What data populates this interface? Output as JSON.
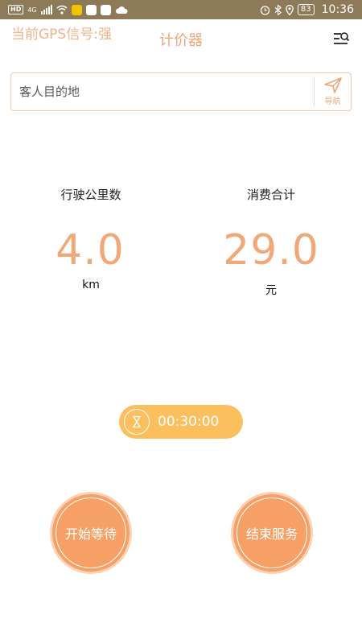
{
  "status_bar": {
    "hd_badge": "HD",
    "network": "4G",
    "battery": "83",
    "time": "10:36"
  },
  "header": {
    "gps_status": "当前GPS信号:强",
    "title": "计价器",
    "menu_icon": "menu-search-icon"
  },
  "destination": {
    "placeholder": "客人目的地",
    "value": "",
    "nav_label": "导航",
    "nav_icon": "navigation-arrow-icon"
  },
  "stats": {
    "distance_label": "行驶公里数",
    "distance_value": "4.0",
    "distance_unit": "km",
    "fare_label": "消费合计",
    "fare_value": "29.0",
    "fare_unit": "元"
  },
  "timer": {
    "icon": "hourglass-icon",
    "value": "00:30:00"
  },
  "actions": {
    "start_wait": "开始等待",
    "end_service": "结束服务"
  },
  "colors": {
    "accent": "#f0a878",
    "button": "#f7a066",
    "timer_bg": "#fbbf5e",
    "status_bar": "#8d7a58"
  }
}
